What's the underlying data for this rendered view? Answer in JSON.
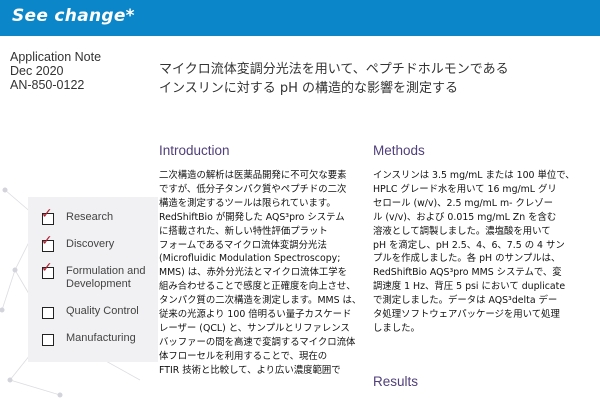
{
  "banner": {
    "title": "See change*",
    "color": "#0a86c9"
  },
  "doc_meta": {
    "type": "Application Note",
    "date": "Dec 2020",
    "number": "AN-850-0122"
  },
  "doc_title": {
    "line1": "マイクロ流体変調分光法を用いて、ペプチドホルモンである",
    "line2": "インスリンに対する pH の構造的な影響を測定する"
  },
  "sidebar_panel": {
    "items": [
      {
        "label": "Research",
        "checked": true
      },
      {
        "label": "Discovery",
        "checked": true
      },
      {
        "label": "Formulation and Development",
        "checked": true
      },
      {
        "label": "Quality Control",
        "checked": false
      },
      {
        "label": "Manufacturing",
        "checked": false
      }
    ],
    "check_icon": "check-mark",
    "check_color": "#b01c2e"
  },
  "introduction": {
    "heading": "Introduction",
    "text": "二次構造の解析は医薬品開発に不可欠な要素\nですが、低分子タンパク質やペプチドの二次\n構造を測定するツールは限られています。\nRedShiftBio が開発した AQS³pro システム\nに搭載された、新しい特性評価プラット\nフォームであるマイクロ流体変調分光法\n(Microfluidic Modulation Spectroscopy;\nMMS) は、赤外分光法とマイクロ流体工学を\n組み合わせることで感度と正確度を向上させ、\nタンパク質の二次構造を測定します。MMS は、\n従来の光源より 100 倍明るい量子カスケード\nレーザー (QCL) と、サンプルとリファレンス\nバッファーの間を高速で変調するマイクロ流体\n体フローセルを利用することで、現在の\nFTIR 技術と比較して、より広い濃度範囲で"
  },
  "methods": {
    "heading": "Methods",
    "text": "インスリンは 3.5 mg/mL または 100 単位で、\nHPLC グレード水を用いて 16 mg/mL グリ\nセロール (w/v)、2.5 mg/mL m- クレゾー\nル (v/v)、および 0.015 mg/mL Zn を含む\n溶液として調製しました。濃塩酸を用いて\npH を滴定し、pH 2.5、4、6、7.5 の 4 サン\nプルを作成しました。各 pH のサンプルは、\nRedShiftBio AQS³pro MMS システムで、変\n調速度 1 Hz、背圧 5 psi において duplicate\nで測定しました。データは AQS³delta デー\nタ処理ソフトウェアパッケージを用いて処理\nしました。"
  },
  "results": {
    "heading": "Results"
  },
  "colors": {
    "heading": "#4f3f7a",
    "panel_bg": "#f1f1f3"
  }
}
